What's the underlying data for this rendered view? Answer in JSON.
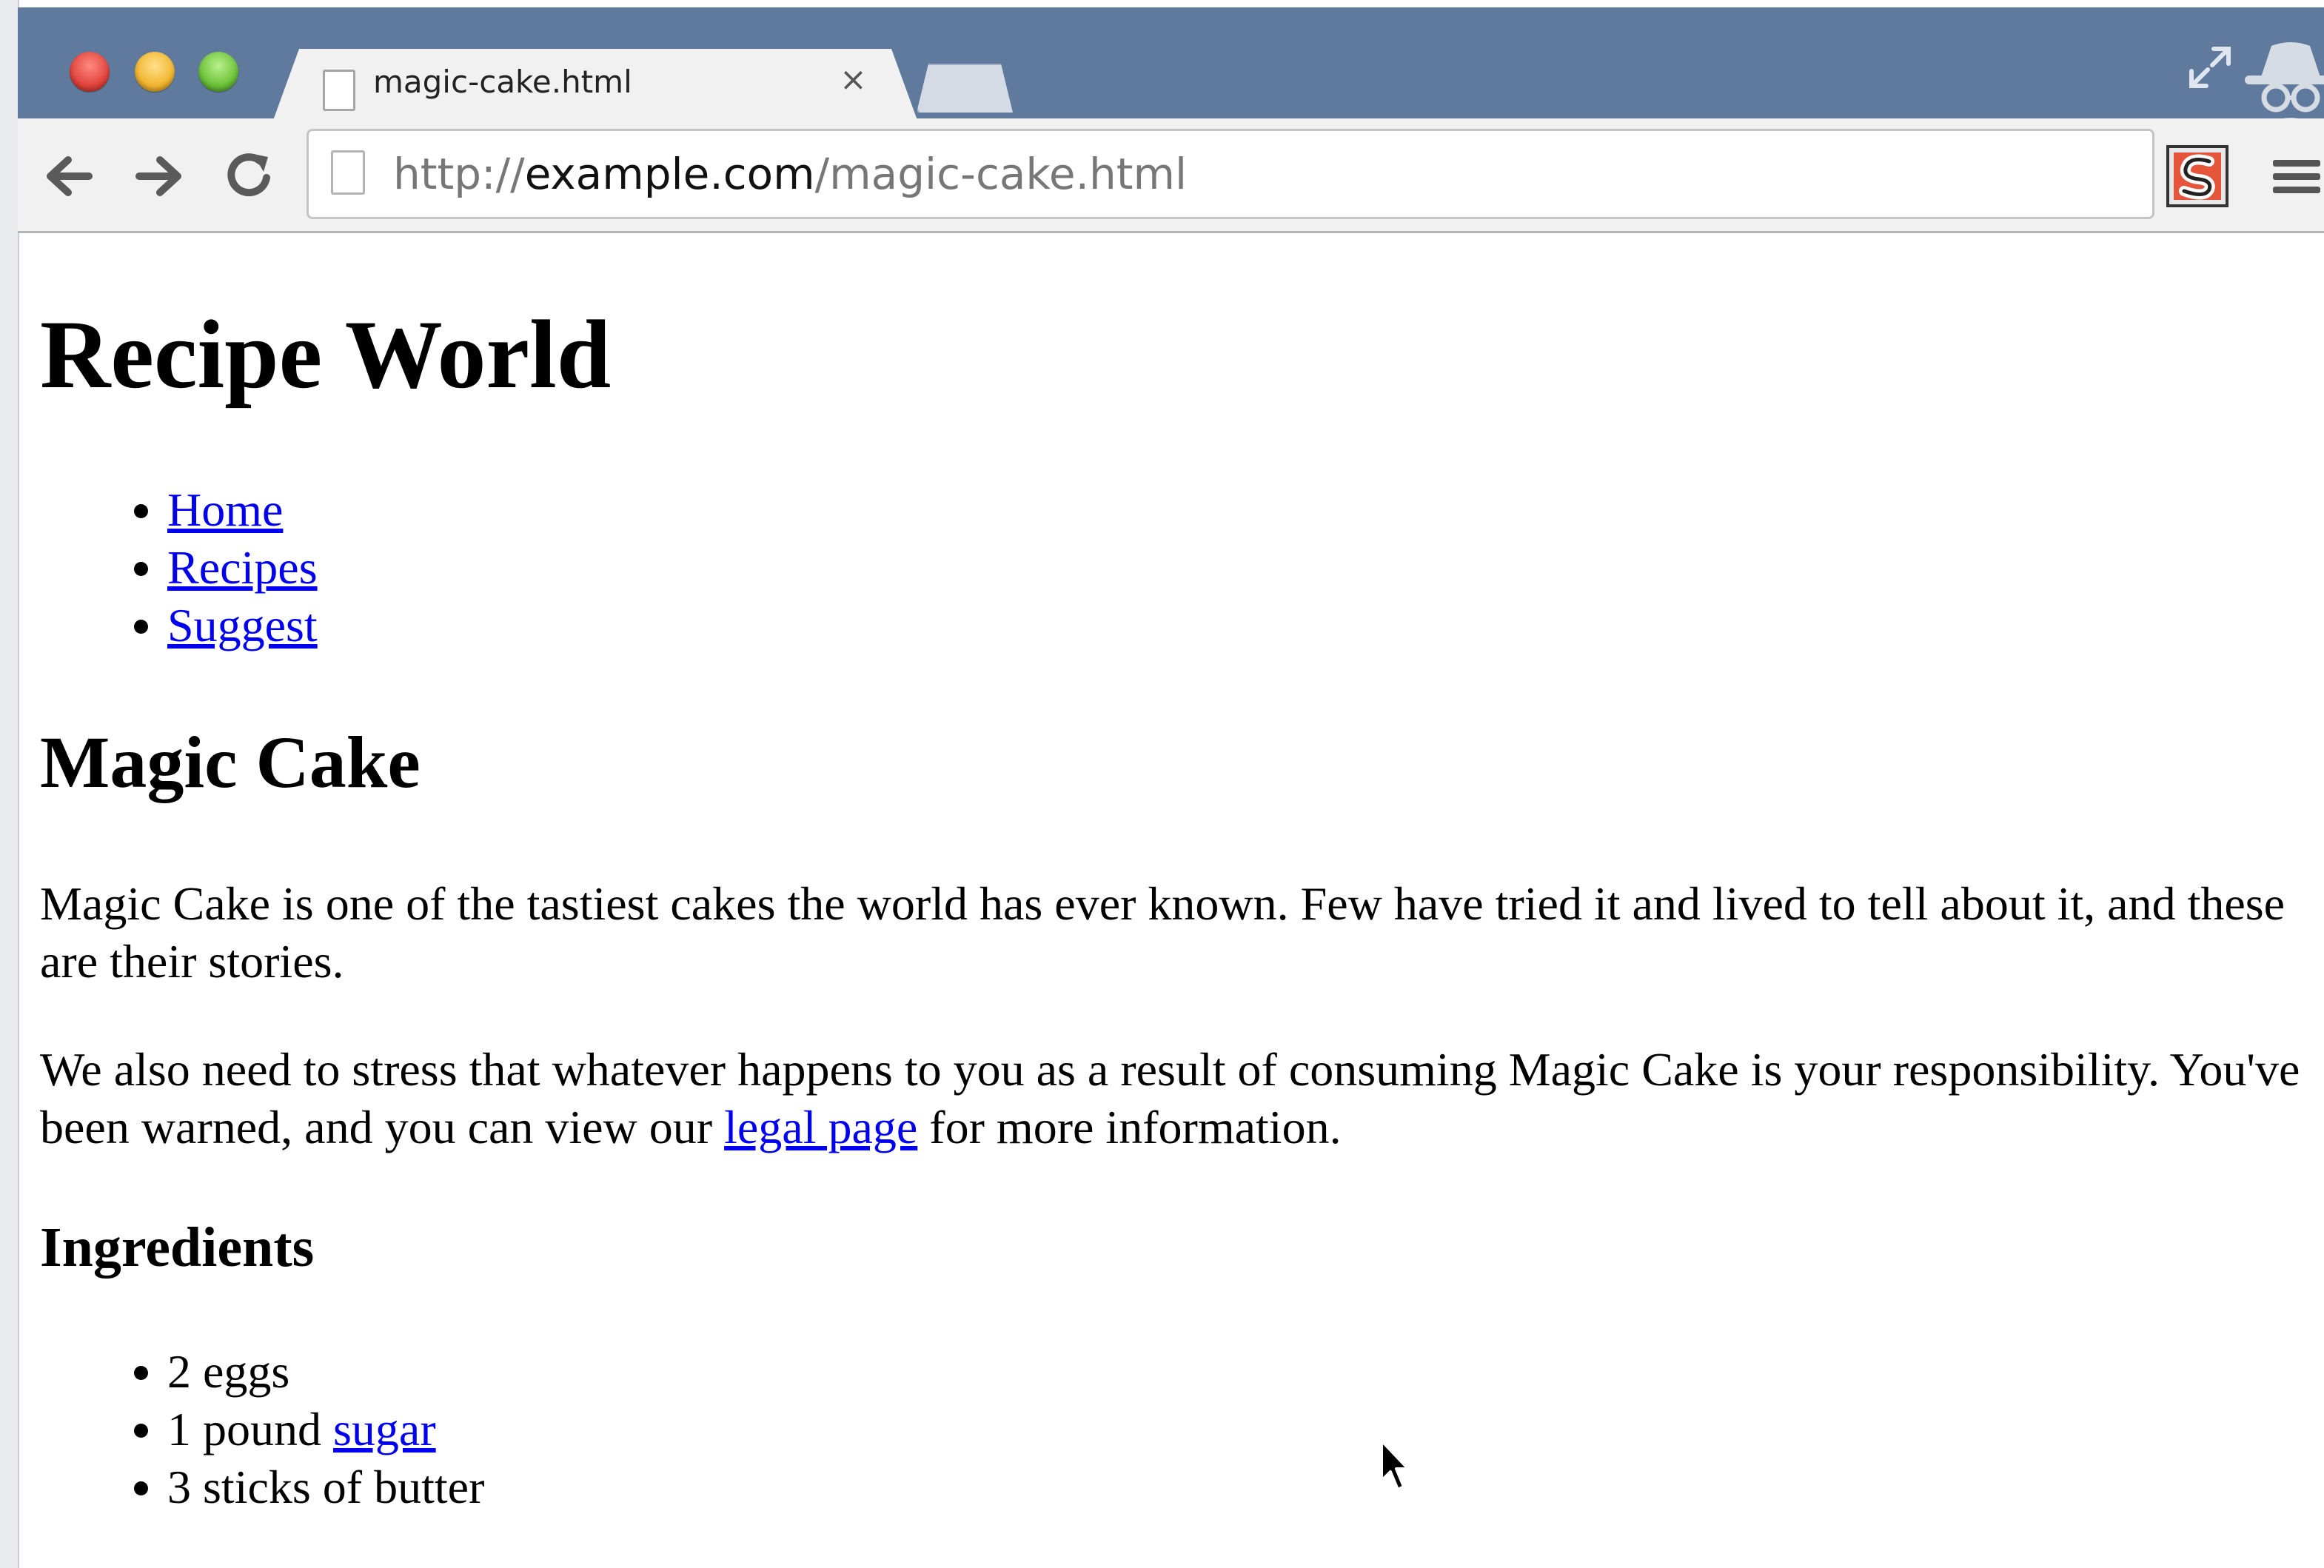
{
  "browser": {
    "tab": {
      "title": "magic-cake.html",
      "close_glyph": "×"
    },
    "address_bar": {
      "scheme": "http://",
      "host": "example.com",
      "path": "/magic-cake.html"
    },
    "icons": {
      "back": "back-arrow-icon",
      "forward": "forward-arrow-icon",
      "reload": "reload-icon",
      "extension": "s-extension-icon",
      "menu": "hamburger-menu-icon",
      "incognito": "incognito-icon",
      "fullscreen": "fullscreen-icon"
    },
    "colors": {
      "titlebar": "#5f7a9c",
      "tab": "#f1f1f1",
      "link": "#0000ee"
    }
  },
  "page": {
    "site_title": "Recipe World",
    "nav": [
      {
        "label": "Home"
      },
      {
        "label": "Recipes"
      },
      {
        "label": "Suggest"
      }
    ],
    "recipe_title": "Magic Cake",
    "intro": "Magic Cake is one of the tastiest cakes the world has ever known. Few have tried it and lived to tell about it, and these are their stories.",
    "warning": {
      "before": "We also need to stress that whatever happens to you as a result of consuming Magic Cake is your responsibility. You've been warned, and you can view our ",
      "link": "legal page",
      "after": " for more information."
    },
    "ingredients_title": "Ingredients",
    "ingredients": {
      "item1": "2 eggs",
      "item2_prefix": "1 pound ",
      "item2_link": "sugar",
      "item3": "3 sticks of butter"
    }
  }
}
